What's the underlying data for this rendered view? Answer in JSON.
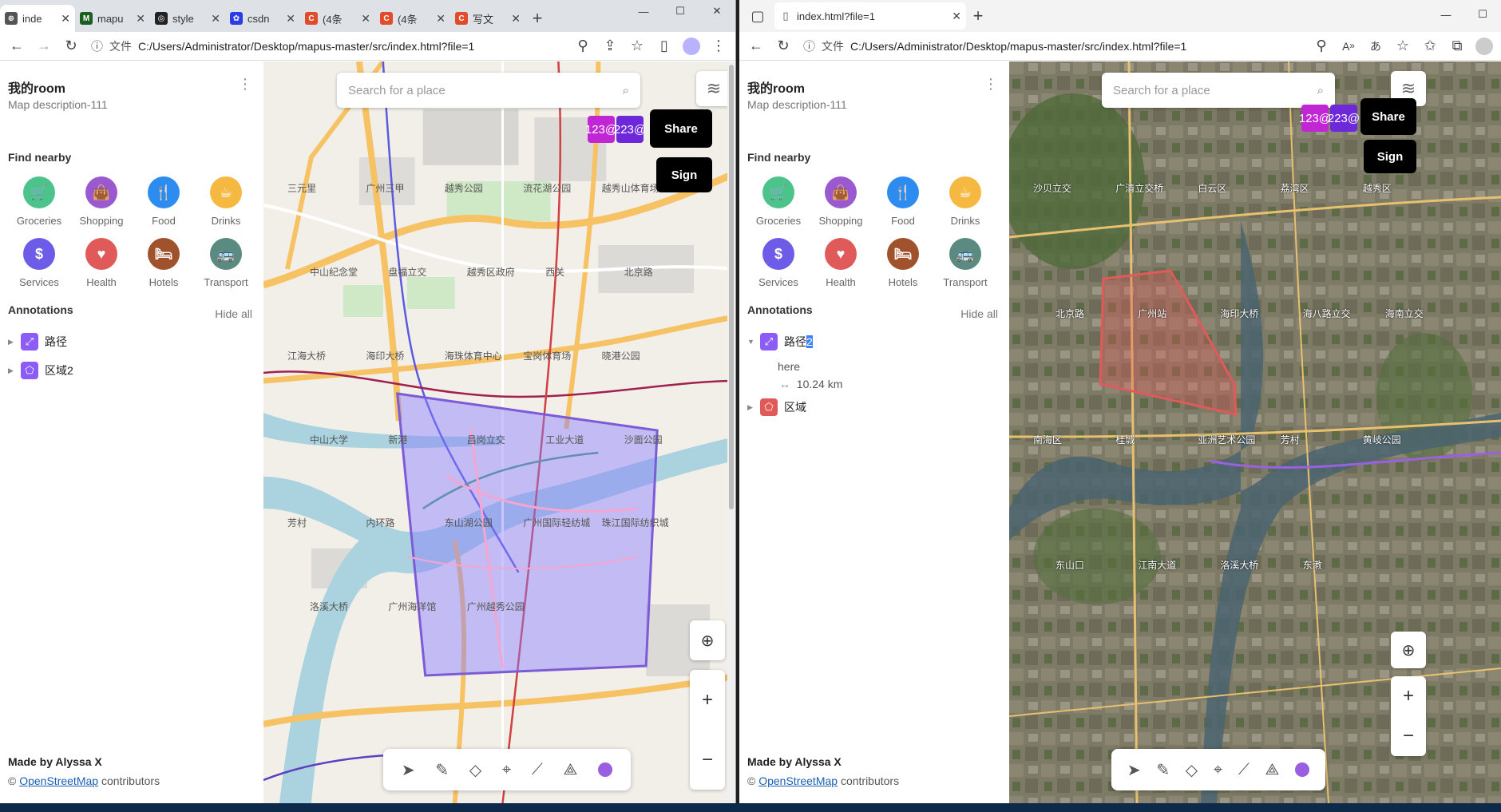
{
  "left_window": {
    "tabs": [
      {
        "title": "inde",
        "fav_color": "#555555",
        "fav": "⊕"
      },
      {
        "title": "mapu",
        "fav_color": "#1b5e20",
        "fav": "M"
      },
      {
        "title": "style",
        "fav_color": "#222222",
        "fav": "◎"
      },
      {
        "title": "csdn",
        "fav_color": "#2c3ce6",
        "fav": "✿"
      },
      {
        "title": "(4条",
        "fav_color": "#e14b2b",
        "fav": "C"
      },
      {
        "title": "(4条",
        "fav_color": "#e14b2b",
        "fav": "C"
      },
      {
        "title": "写文",
        "fav_color": "#e14b2b",
        "fav": "C"
      }
    ],
    "addr_label": "文件",
    "url": "C:/Users/Administrator/Desktop/mapus-master/src/index.html?file=1",
    "panel": {
      "title": "我的room",
      "description": "Map description-111",
      "find_nearby": "Find nearby",
      "annotations": "Annotations",
      "hide_all": "Hide all",
      "items": [
        {
          "label": "路径",
          "icon": "path-icon",
          "color": "#8b5cf6"
        },
        {
          "label": "区域2",
          "icon": "polygon-icon",
          "color": "#8b5cf6"
        }
      ],
      "made_by": "Made by Alyssa X",
      "osm_link": "OpenStreetMap",
      "osm_rest": " contributors"
    },
    "map": {
      "search_placeholder": "Search for a place",
      "user1": "123@",
      "user2": "223@",
      "share": "Share",
      "sign": "Sign"
    }
  },
  "right_window": {
    "tab_title": "index.html?file=1",
    "addr_label": "文件",
    "url": "C:/Users/Administrator/Desktop/mapus-master/src/index.html?file=1",
    "panel": {
      "title": "我的room",
      "description": "Map description-111",
      "find_nearby": "Find nearby",
      "annotations": "Annotations",
      "hide_all": "Hide all",
      "path_label": "路径",
      "path_label_sel": "2",
      "path_desc": "here",
      "path_distance": "10.24 km",
      "area_label": "区域",
      "made_by": "Made by Alyssa X",
      "osm_link": "OpenStreetMap",
      "osm_rest": " contributors"
    },
    "map": {
      "search_placeholder": "Search for a place",
      "user1": "123@",
      "user2": "223@",
      "share": "Share",
      "sign": "Sign"
    }
  },
  "nearby": [
    {
      "label": "Groceries",
      "color": "#4cc38a",
      "glyph": "🛒"
    },
    {
      "label": "Shopping",
      "color": "#9b59d0",
      "glyph": "👜"
    },
    {
      "label": "Food",
      "color": "#2d8cf0",
      "glyph": "🍴"
    },
    {
      "label": "Drinks",
      "color": "#f5b942",
      "glyph": "☕"
    },
    {
      "label": "Services",
      "color": "#6c5ce7",
      "glyph": "$"
    },
    {
      "label": "Health",
      "color": "#e05a5a",
      "glyph": "♥"
    },
    {
      "label": "Hotels",
      "color": "#a0522d",
      "glyph": "🛏"
    },
    {
      "label": "Transport",
      "color": "#5b8a80",
      "glyph": "🚌"
    }
  ],
  "map_labels_left": [
    "三元里",
    "广州三甲",
    "越秀公园",
    "流花湖公园",
    "越秀山体育场",
    "中山纪念堂",
    "盘福立交",
    "越秀区政府",
    "西关",
    "北京路",
    "江海大桥",
    "海印大桥",
    "海珠体育中心",
    "宝岗体育场",
    "晓港公园",
    "中山大学",
    "新港",
    "昌岗立交",
    "工业大道",
    "沙面公园",
    "芳村",
    "内环路",
    "东山湖公园",
    "广州国际轻纺城",
    "珠江国际纺织城",
    "洛溪大桥",
    "广州海洋馆",
    "广州越秀公园"
  ],
  "map_labels_right": [
    "沙贝立交",
    "广清立交桥",
    "白云区",
    "荔湾区",
    "越秀区",
    "北京路",
    "广州站",
    "海印大桥",
    "海八路立交",
    "海南立交",
    "南海区",
    "桂城",
    "亚洲艺术公园",
    "芳村",
    "黄岐公园",
    "东山口",
    "江南大道",
    "洛溪大桥",
    "东漖"
  ],
  "colors": {
    "purple_user": "#c026d3",
    "indigo_user": "#6d28d9",
    "polygon_fill": "#8a7cff",
    "polygon_stroke": "#7c5bd6",
    "polygon_red": "#e05a5a"
  }
}
